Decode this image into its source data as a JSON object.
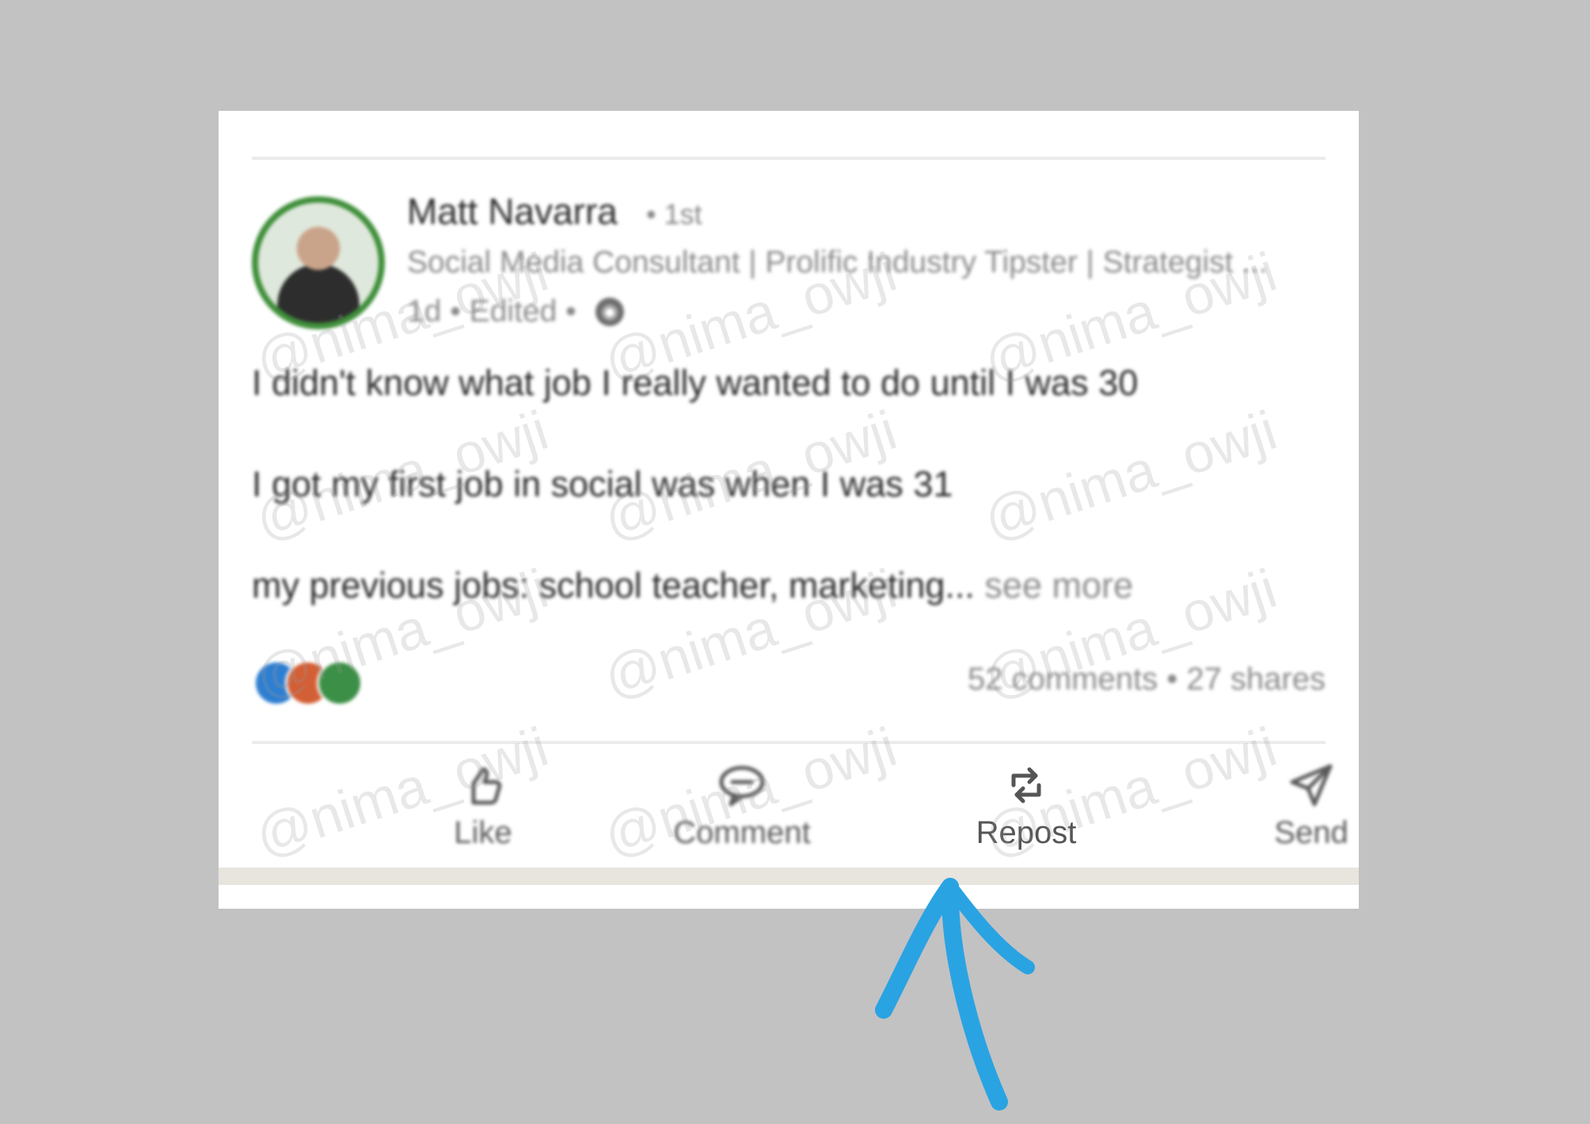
{
  "post": {
    "author": {
      "name": "Matt Navarra",
      "degree": "• 1st",
      "headline": "Social Media Consultant | Prolific Industry Tipster | Strategist ...",
      "meta": "1d • Edited •"
    },
    "body": {
      "line1": "I didn't know what job I really wanted to do until I was 30",
      "line2": "I got my first job in social was when I was 31",
      "line3": "my previous jobs: school teacher, marketing...",
      "see_more": " see more"
    },
    "social_counts": "52 comments • 27 shares",
    "actions": {
      "like": "Like",
      "comment": "Comment",
      "repost": "Repost",
      "send": "Send"
    }
  },
  "watermark": "@nima_owji",
  "colors": {
    "background": "#c2c2c2",
    "annotation_arrow": "#2aa3e3",
    "avatar_ring": "#3f8f3a"
  },
  "icons": {
    "like": "thumbs-up-icon",
    "comment": "comment-bubble-icon",
    "repost": "repost-icon",
    "send": "send-icon",
    "globe": "globe-icon"
  }
}
